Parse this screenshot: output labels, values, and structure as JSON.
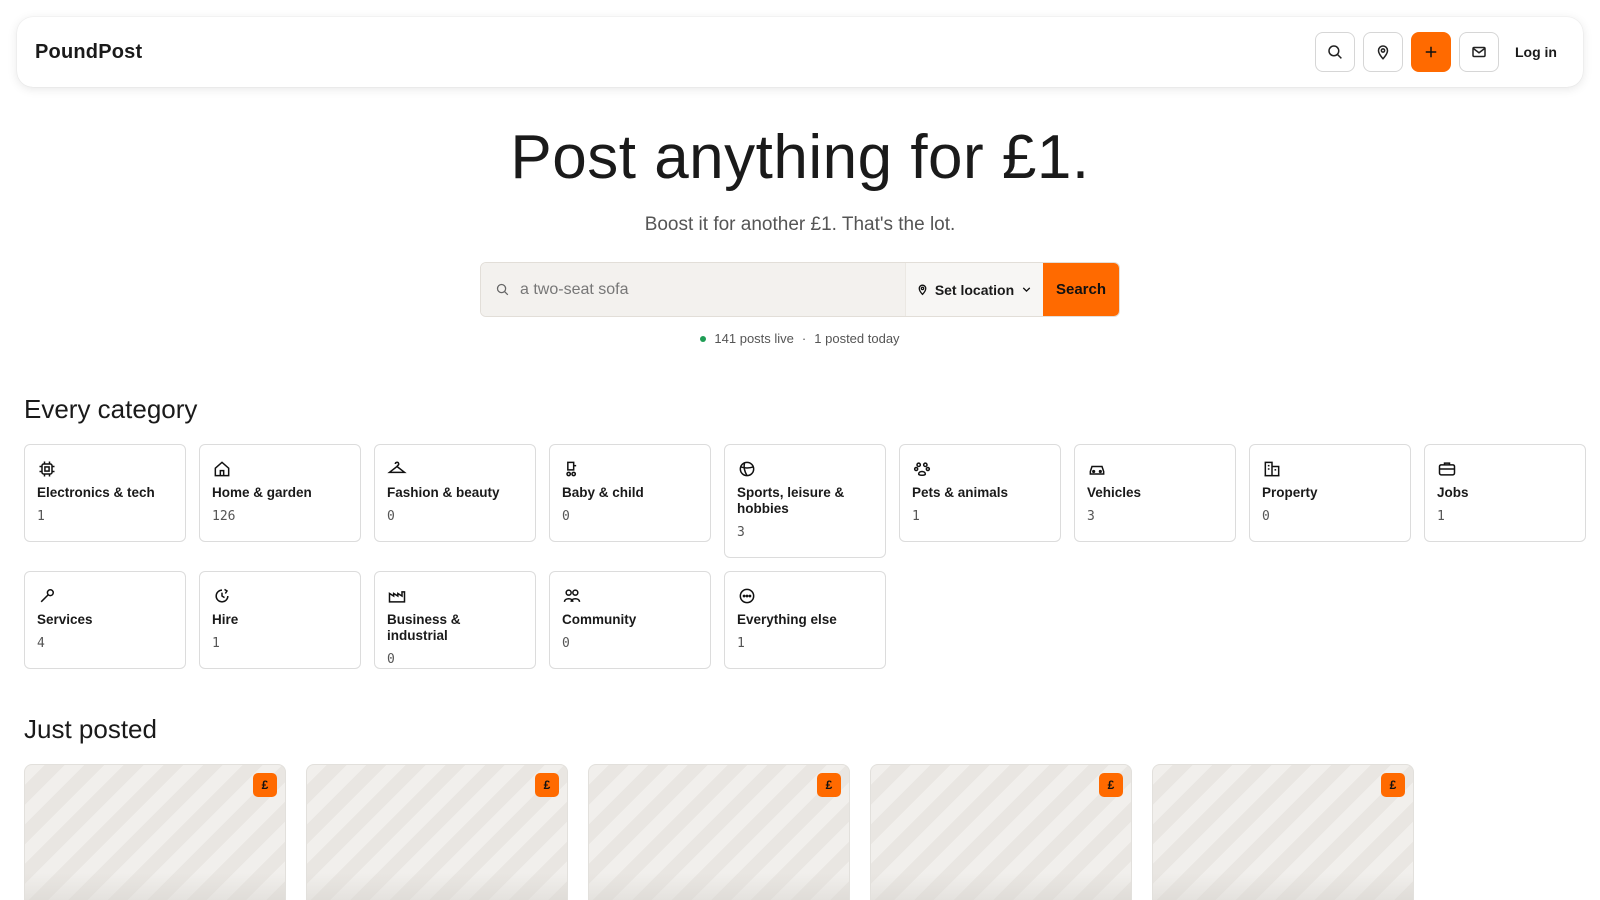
{
  "header": {
    "brand": "PoundPost",
    "login_label": "Log in"
  },
  "hero": {
    "title": "Post anything for £1.",
    "subtitle": "Boost it for another £1. That's the lot."
  },
  "search": {
    "placeholder": "a two-seat sofa",
    "location_label": "Set location",
    "button_label": "Search"
  },
  "stats": {
    "live": "141 posts live",
    "separator": "·",
    "today": "1 posted today"
  },
  "categories_title": "Every category",
  "categories": [
    {
      "name": "Electronics & tech",
      "count": "1",
      "icon": "chip-icon"
    },
    {
      "name": "Home & garden",
      "count": "126",
      "icon": "house-icon"
    },
    {
      "name": "Fashion & beauty",
      "count": "0",
      "icon": "hanger-icon"
    },
    {
      "name": "Baby & child",
      "count": "0",
      "icon": "pram-icon"
    },
    {
      "name": "Sports, leisure & hobbies",
      "count": "3",
      "icon": "ball-icon"
    },
    {
      "name": "Pets & animals",
      "count": "1",
      "icon": "paw-icon"
    },
    {
      "name": "Vehicles",
      "count": "3",
      "icon": "car-icon"
    },
    {
      "name": "Property",
      "count": "0",
      "icon": "building-icon"
    },
    {
      "name": "Jobs",
      "count": "1",
      "icon": "briefcase-icon"
    },
    {
      "name": "Services",
      "count": "4",
      "icon": "wrench-icon"
    },
    {
      "name": "Hire",
      "count": "1",
      "icon": "clock-icon"
    },
    {
      "name": "Business & industrial",
      "count": "0",
      "icon": "factory-icon"
    },
    {
      "name": "Community",
      "count": "0",
      "icon": "people-icon"
    },
    {
      "name": "Everything else",
      "count": "1",
      "icon": "ellipsis-icon"
    }
  ],
  "posts_title": "Just posted",
  "post_badge": "£",
  "colors": {
    "accent": "#ff6a00",
    "live_dot": "#1f9d55"
  }
}
